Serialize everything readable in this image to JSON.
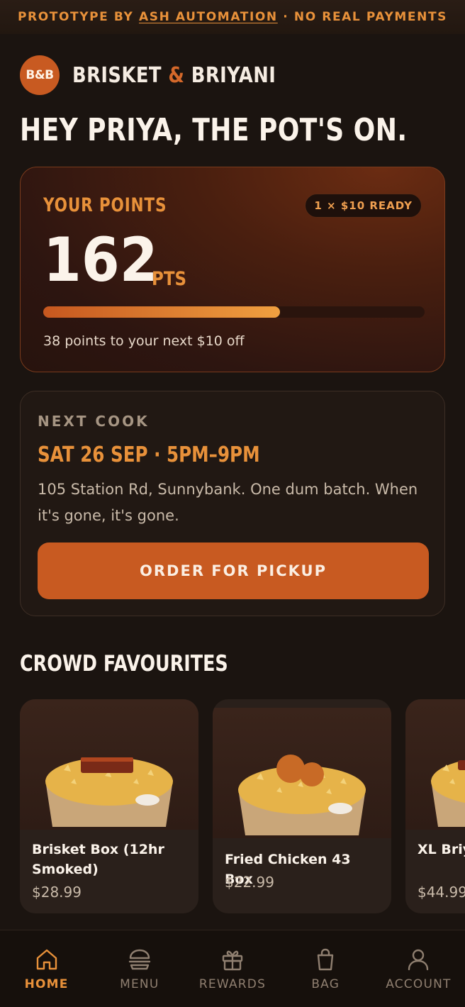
{
  "banner": {
    "prefix": "PROTOTYPE BY",
    "link": "ASH AUTOMATION",
    "suffix": "· NO REAL PAYMENTS"
  },
  "brand": {
    "logo": "B&B",
    "name_part1": "BRISKET",
    "amp": "&",
    "name_part2": "BRIYANI"
  },
  "greeting": "HEY PRIYA, THE POT'S ON.",
  "points": {
    "label": "YOUR POINTS",
    "badge": "1 × $10 READY",
    "value": "162",
    "unit": "PTS",
    "progress_fraction": 0.62,
    "note": "38 points to your next $10 off"
  },
  "next_cook": {
    "label": "NEXT COOK",
    "date": "SAT 26 SEP · 5PM–9PM",
    "description": "105 Station Rd, Sunnybank. One dum batch. When it's gone, it's gone.",
    "button": "ORDER FOR PICKUP"
  },
  "favourites": {
    "title": "CROWD FAVOURITES",
    "items": [
      {
        "name": "Brisket Box (12hr Smoked)",
        "price": "$28.99"
      },
      {
        "name": "Fried Chicken 43 Box",
        "price": "$22.99"
      },
      {
        "name": "XL Briyani Meats",
        "price": "$44.99"
      }
    ]
  },
  "nav": {
    "items": [
      {
        "label": "HOME",
        "icon": "home-icon"
      },
      {
        "label": "MENU",
        "icon": "burger-icon"
      },
      {
        "label": "REWARDS",
        "icon": "gift-icon"
      },
      {
        "label": "BAG",
        "icon": "bag-icon"
      },
      {
        "label": "ACCOUNT",
        "icon": "user-icon"
      }
    ],
    "active": "HOME"
  },
  "colors": {
    "accent": "#e8913a",
    "brand": "#c85a21",
    "background": "#1b1410"
  }
}
